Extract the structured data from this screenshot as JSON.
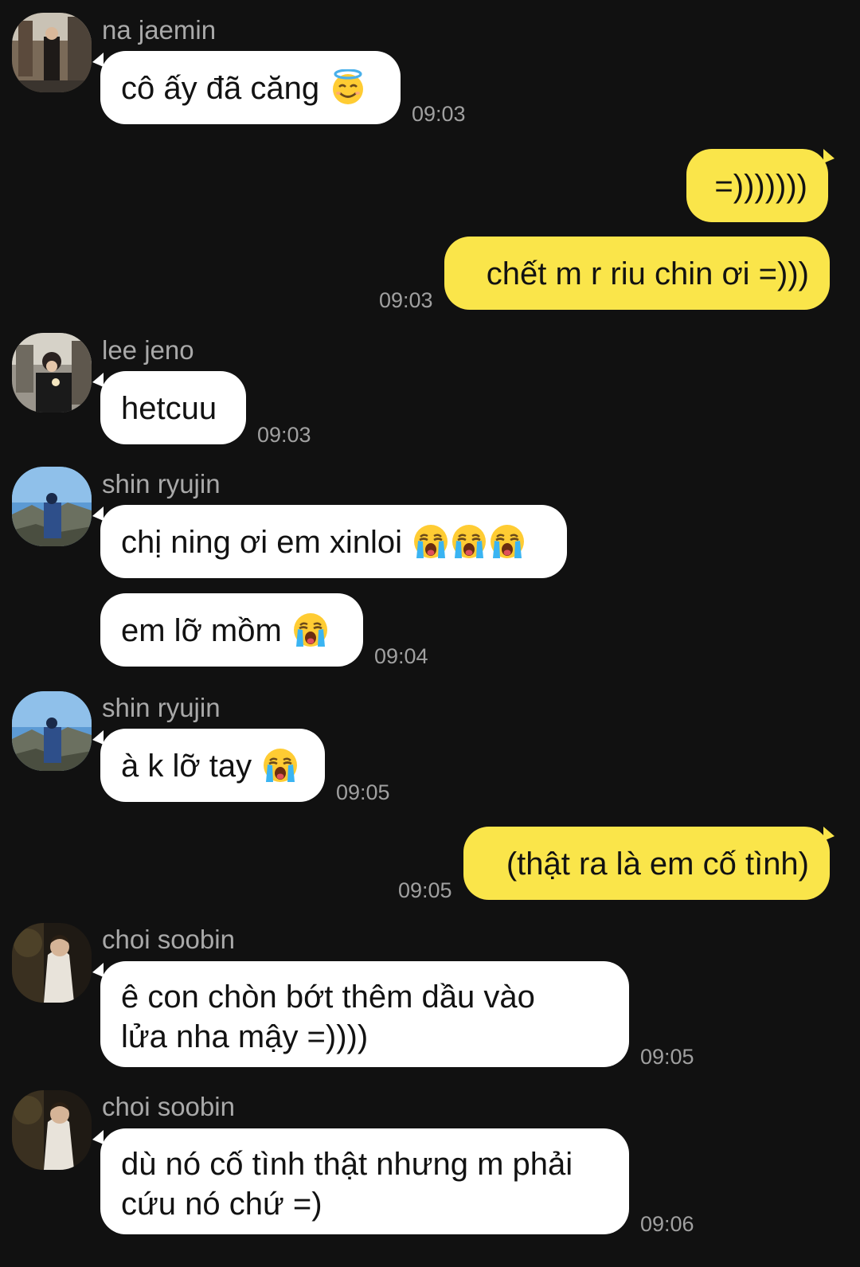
{
  "colors": {
    "background": "#111111",
    "incoming_bubble": "#ffffff",
    "outgoing_bubble": "#fae54a",
    "sender_name": "#a9a9a9",
    "timestamp": "#a0a0a0"
  },
  "messages": [
    {
      "sender": "na jaemin",
      "text": "cô ấy đã căng",
      "emoji": "smiling-face-with-halo-icon",
      "time": "09:03"
    },
    {
      "from": "me",
      "text": "=)))))))"
    },
    {
      "from": "me",
      "text": "chết m r riu chin ơi =)))",
      "time": "09:03"
    },
    {
      "sender": "lee jeno",
      "text": "hetcuu",
      "time": "09:03"
    },
    {
      "sender": "shin ryujin",
      "text": "chị ning ơi em xinloi",
      "emoji": "loudly-crying-face-icon x3"
    },
    {
      "text": "em lỡ mồm",
      "emoji": "loudly-crying-face-icon",
      "time": "09:04"
    },
    {
      "sender": "shin ryujin",
      "text": "à k lỡ tay",
      "emoji": "loudly-crying-face-icon",
      "time": "09:05"
    },
    {
      "from": "me",
      "text": "(thật ra là em cố tình)",
      "time": "09:05"
    },
    {
      "sender": "choi soobin",
      "lines": [
        "ê con chòn bớt thêm dầu vào",
        "lửa nha mậy =))))"
      ],
      "time": "09:05"
    },
    {
      "sender": "choi soobin",
      "lines": [
        "dù nó cố tình thật nhưng m phải",
        "cứu nó chứ =)"
      ],
      "time": "09:06"
    }
  ]
}
